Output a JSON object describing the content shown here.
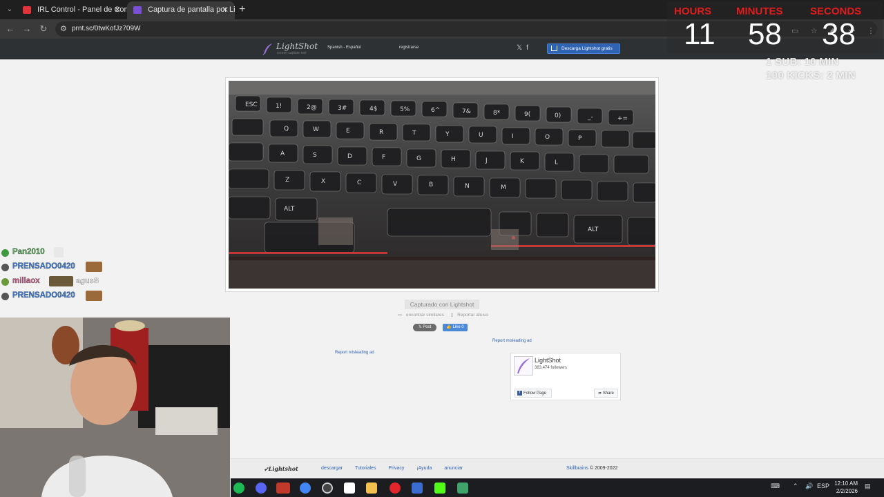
{
  "browser": {
    "tabs": [
      {
        "title": "IRL Control - Panel de Control d",
        "active": false,
        "favicon_color": "#e0333a"
      },
      {
        "title": "Captura de pantalla por Lightsh",
        "active": true,
        "favicon_color": "#7a4fd6"
      }
    ],
    "new_tab": "+",
    "address": "prnt.sc/0twKofJz709W"
  },
  "lightshot": {
    "header": {
      "logo_name": "LightShot",
      "logo_tagline": "screen capture tool",
      "language": "Spanish - Español",
      "register": "registrarse",
      "download_button": "Descarga Lightshot gratis"
    },
    "caption": "Capturado con Lightshot",
    "sublinks": [
      "encontrar similares",
      "Reportar abuso"
    ],
    "post_button": "Post",
    "like_button": "Like 0",
    "ad_links": [
      "Report misleading ad",
      "Report misleading ad"
    ],
    "facebook": {
      "page_name": "LightShot",
      "followers": "383,474 followers",
      "follow_label": "Follow Page",
      "share_label": "Share"
    },
    "footer": {
      "logo": "Lightshot",
      "links": [
        "descargar",
        "Tutoriales",
        "Privacy",
        "¡Ayuda",
        "anunciar"
      ],
      "brand": "Skillbrains",
      "copyright": "© 2009-2022"
    }
  },
  "overlay": {
    "timer": {
      "labels": [
        "HOURS",
        "MINUTES",
        "SECONDS"
      ],
      "values": [
        "11",
        "58",
        "38"
      ]
    },
    "promo_lines": [
      "1 SUB: 10 MIN",
      "100 KICKS: 2 MIN"
    ],
    "chat": [
      {
        "user": "Pan2010",
        "color": "#5db05d",
        "badge_color": "#3f9a3f",
        "message": ""
      },
      {
        "user": "PRENSADO0420",
        "color": "#3d7fe0",
        "badge_color": "#555",
        "message": ""
      },
      {
        "user": "millaox",
        "color": "#d65a8a",
        "badge_color": "#6a9a3a",
        "message": "agusS"
      },
      {
        "user": "PRENSADO0420",
        "color": "#3d7fe0",
        "badge_color": "#555",
        "message": ""
      }
    ]
  },
  "taskbar": {
    "icons": [
      "spotify-icon",
      "discord-icon",
      "voicemod-icon",
      "chrome-icon",
      "obs-icon",
      "app-icon",
      "folder-icon",
      "opera-icon",
      "app2-icon",
      "kick-icon",
      "stack-icon"
    ],
    "language": "ESP",
    "time": "12:10 AM",
    "date": "2/2/2026"
  }
}
